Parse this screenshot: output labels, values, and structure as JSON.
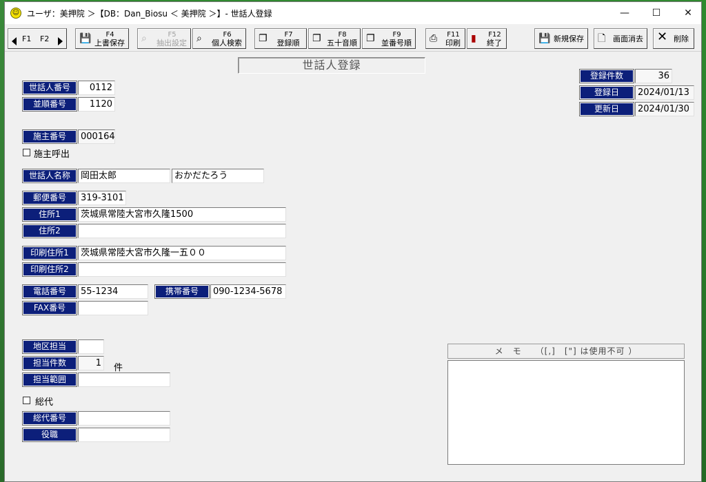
{
  "window": {
    "title": "ユーザ：美押院 ＞【DB：Dan_Biosu ＜ 美押院 ＞】- 世話人登録",
    "minimize": "—",
    "maximize": "☐",
    "close": "✕"
  },
  "toolbar": {
    "f1": "F1",
    "f2": "F2",
    "buttons": [
      {
        "key": "F4",
        "label": "上書保存",
        "icon": "floppy-icon",
        "enabled": true
      },
      {
        "key": "F5",
        "label": "抽出設定",
        "icon": "binoculars-icon",
        "enabled": false
      },
      {
        "key": "F6",
        "label": "個人検索",
        "icon": "binoculars-icon",
        "enabled": true
      },
      {
        "key": "F7",
        "label": "登録順",
        "icon": "pages-icon",
        "enabled": true
      },
      {
        "key": "F8",
        "label": "五十音順",
        "icon": "pages-icon",
        "enabled": true
      },
      {
        "key": "F9",
        "label": "並番号順",
        "icon": "pages-icon",
        "enabled": true
      },
      {
        "key": "F11",
        "label": "印刷",
        "icon": "printer-icon",
        "enabled": true
      },
      {
        "key": "F12",
        "label": "終了",
        "icon": "exit-door-icon",
        "enabled": true
      }
    ],
    "new_save": "新規保存",
    "clear_screen": "画面消去",
    "delete": "削除"
  },
  "form": {
    "title": "世話人登録",
    "caretaker_no_label": "世話人番号",
    "caretaker_no": "0112",
    "order_no_label": "並順番号",
    "order_no": "1120",
    "registered_count_label": "登録件数",
    "registered_count": "36",
    "registered_date_label": "登録日",
    "registered_date": "2024/01/13",
    "updated_date_label": "更新日",
    "updated_date": "2024/01/30",
    "patron_no_label": "施主番号",
    "patron_no": "000164",
    "patron_call_label": "施主呼出",
    "name_label": "世話人名称",
    "name": "岡田太郎",
    "name_kana": "おかだたろう",
    "postal_label": "郵便番号",
    "postal": "319-3101",
    "address1_label": "住所1",
    "address1": "茨城県常陸大宮市久隆1500",
    "address2_label": "住所2",
    "address2": "",
    "print_address1_label": "印刷住所1",
    "print_address1": "茨城県常陸大宮市久隆一五００",
    "print_address2_label": "印刷住所2",
    "print_address2": "",
    "phone_label": "電話番号",
    "phone": "55-1234",
    "mobile_label": "携帯番号",
    "mobile": "090-1234-5678",
    "fax_label": "FAX番号",
    "fax": "",
    "district_label": "地区担当",
    "district": "",
    "assigned_count_label": "担当件数",
    "assigned_count": "1",
    "assigned_count_unit": "件",
    "assigned_range_label": "担当範囲",
    "assigned_range": "",
    "general_rep_label": "総代",
    "general_rep_no_label": "総代番号",
    "general_rep_no": "",
    "position_label": "役職",
    "position": "",
    "memo_header": "メ　モ　　（[,]　[\"] は使用不可 ）",
    "memo": ""
  }
}
